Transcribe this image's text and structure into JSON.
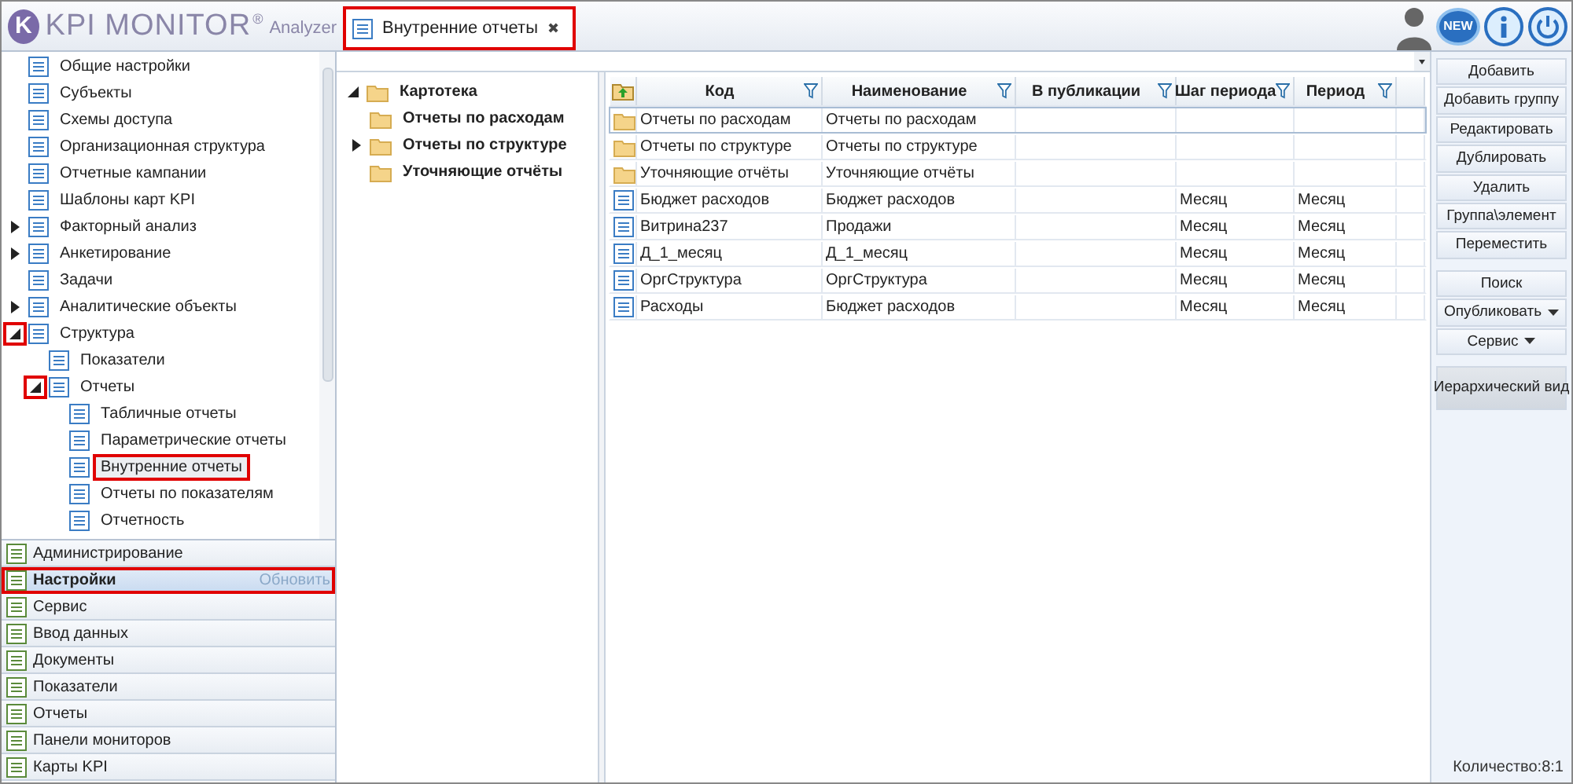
{
  "logo": {
    "badge": "K",
    "brand": "KPI MONITOR",
    "reg": "®",
    "suffix": "Analyzer"
  },
  "tab": {
    "title": "Внутренние отчеты",
    "close": "✖",
    "selected": true,
    "highlighted": true
  },
  "header_icons": {
    "news": "NEW"
  },
  "nav_tree": [
    {
      "label": "Общие настройки",
      "selected": false
    },
    {
      "label": "Субъекты",
      "selected": false
    },
    {
      "label": "Схемы доступа",
      "selected": false
    },
    {
      "label": "Организационная структура",
      "selected": false
    },
    {
      "label": "Отчетные кампании",
      "selected": false
    },
    {
      "label": "Шаблоны карт KPI",
      "selected": false
    },
    {
      "label": "Факторный анализ",
      "selected": false,
      "expanded": false
    },
    {
      "label": "Анкетирование",
      "selected": false,
      "expanded": false
    },
    {
      "label": "Задачи",
      "selected": false
    },
    {
      "label": "Аналитические объекты",
      "selected": false,
      "expanded": false
    },
    {
      "label": "Структура",
      "selected": false,
      "expanded": true,
      "toggle_highlighted": true,
      "children": [
        {
          "label": "Показатели",
          "selected": false
        },
        {
          "label": "Отчеты",
          "selected": false,
          "expanded": true,
          "toggle_highlighted": true,
          "children": [
            {
              "label": "Табличные отчеты",
              "selected": false
            },
            {
              "label": "Параметрические отчеты",
              "selected": false
            },
            {
              "label": "Внутренние отчеты",
              "selected": true,
              "highlighted": true
            },
            {
              "label": "Отчеты по показателям",
              "selected": false
            },
            {
              "label": "Отчетность",
              "selected": false
            }
          ]
        }
      ]
    }
  ],
  "accordion": [
    {
      "label": "Администрирование",
      "selected": false
    },
    {
      "label": "Настройки",
      "selected": true,
      "action": "Обновить",
      "highlighted": true
    },
    {
      "label": "Сервис",
      "selected": false
    },
    {
      "label": "Ввод данных",
      "selected": false
    },
    {
      "label": "Документы",
      "selected": false
    },
    {
      "label": "Показатели",
      "selected": false
    },
    {
      "label": "Отчеты",
      "selected": false
    },
    {
      "label": "Панели мониторов",
      "selected": false
    },
    {
      "label": "Карты KPI",
      "selected": false
    }
  ],
  "folder_tree": {
    "label": "Картотека",
    "expanded": true,
    "children": [
      {
        "label": "Отчеты по расходам"
      },
      {
        "label": "Отчеты по структуре",
        "expanded": false
      },
      {
        "label": "Уточняющие отчёты"
      }
    ]
  },
  "table": {
    "columns": [
      "Код",
      "Наименование",
      "В публикации",
      "Шаг периода",
      "Период"
    ],
    "rows": [
      {
        "kind": "folder",
        "selected": true,
        "code": "Отчеты по расходам",
        "name": "Отчеты по расходам"
      },
      {
        "kind": "folder",
        "selected": false,
        "code": "Отчеты по структуре",
        "name": "Отчеты по структуре"
      },
      {
        "kind": "folder",
        "selected": false,
        "code": "Уточняющие отчёты",
        "name": "Уточняющие отчёты"
      },
      {
        "kind": "report",
        "selected": false,
        "code": "Бюджет расходов",
        "name": "Бюджет расходов",
        "step": "Месяц",
        "period": "Месяц"
      },
      {
        "kind": "report",
        "selected": false,
        "code": "Витрина237",
        "name": "Продажи",
        "step": "Месяц",
        "period": "Месяц"
      },
      {
        "kind": "report",
        "selected": false,
        "code": "Д_1_месяц",
        "name": "Д_1_месяц",
        "step": "Месяц",
        "period": "Месяц"
      },
      {
        "kind": "report",
        "selected": false,
        "code": "ОргСтруктура",
        "name": "ОргСтруктура",
        "step": "Месяц",
        "period": "Месяц"
      },
      {
        "kind": "report",
        "selected": false,
        "code": "Расходы",
        "name": "Бюджет расходов",
        "step": "Месяц",
        "period": "Месяц"
      }
    ]
  },
  "button_groups": [
    [
      {
        "label": "Добавить",
        "kind": "plain"
      },
      {
        "label": "Добавить группу",
        "kind": "plain"
      },
      {
        "label": "Редактировать",
        "kind": "plain"
      },
      {
        "label": "Дублировать",
        "kind": "plain"
      },
      {
        "label": "Удалить",
        "kind": "plain"
      },
      {
        "label": "Группа\\элемент",
        "kind": "plain"
      },
      {
        "label": "Переместить",
        "kind": "plain"
      }
    ],
    [
      {
        "label": "Поиск",
        "kind": "plain"
      },
      {
        "label": "Опубликовать",
        "kind": "dropdown"
      },
      {
        "label": "Сервис",
        "kind": "dropdown"
      }
    ],
    [
      {
        "label": "Иерархический вид",
        "kind": "toggle",
        "pressed": true
      }
    ]
  ],
  "status": "Количество:8:1"
}
